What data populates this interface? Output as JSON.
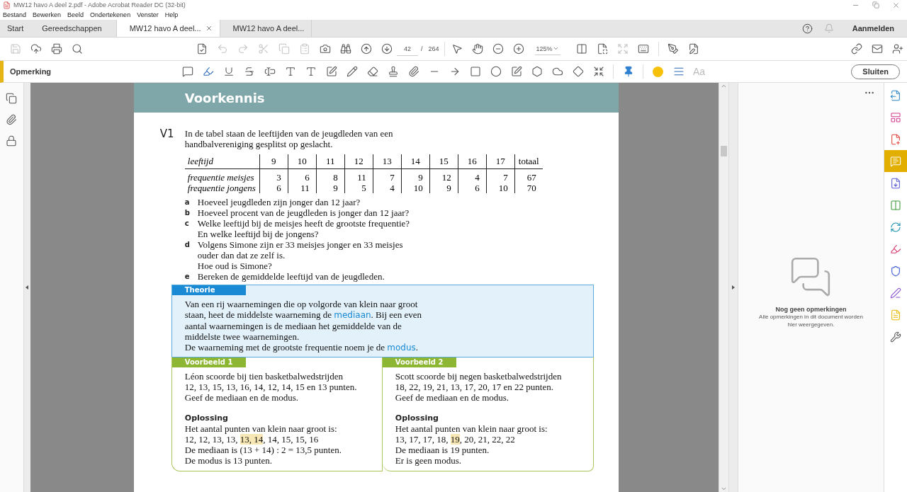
{
  "window": {
    "title": "MW12 havo A deel 2.pdf - Adobe Acrobat Reader DC (32-bit)"
  },
  "menu": [
    "Bestand",
    "Bewerken",
    "Beeld",
    "Ondertekenen",
    "Venster",
    "Help"
  ],
  "tabs": [
    {
      "label": "Start",
      "kind": "nav",
      "selected": false
    },
    {
      "label": "Gereedschappen",
      "kind": "nav",
      "selected": false
    },
    {
      "label": "MW12 havo A deel...",
      "kind": "document",
      "selected": true
    },
    {
      "label": "MW12 havo A deel...",
      "kind": "document",
      "selected": false
    }
  ],
  "account": {
    "sign_in": "Aanmelden"
  },
  "toolbar": {
    "buttons": [
      {
        "disabled": true
      },
      {
        "disabled": false
      },
      {
        "disabled": false
      },
      {
        "disabled": false
      },
      {
        "disabled": false
      },
      {
        "disabled": true
      },
      {
        "disabled": true
      },
      {
        "disabled": true
      },
      {
        "disabled": true
      },
      {
        "disabled": true
      },
      {
        "disabled": false
      },
      {
        "disabled": false
      },
      {
        "disabled": false
      },
      {
        "disabled": false
      },
      {
        "disabled": false
      },
      {
        "disabled": false
      },
      {
        "disabled": false
      },
      {
        "disabled": false
      },
      {
        "disabled": false
      },
      {
        "disabled": false
      },
      {
        "disabled": true
      },
      {
        "disabled": false
      },
      {
        "disabled": false
      },
      {
        "disabled": false
      },
      {
        "disabled": false
      },
      {
        "disabled": false
      },
      {
        "disabled": false
      }
    ],
    "page": {
      "value": "42",
      "separator": "/",
      "total": "264"
    },
    "zoom": {
      "value": "125%"
    }
  },
  "comment_toolbar": {
    "title": "Opmerking",
    "font_sample": "Aa",
    "close": "Sluiten"
  },
  "document": {
    "heading": "Voorkennis",
    "exercise": {
      "number": "V1",
      "intro": [
        "In de tabel staan de leeftijden van de jeugdleden van een",
        "handbalvereniging gesplitst op geslacht."
      ],
      "table": {
        "header": [
          "leeftijd",
          "9",
          "10",
          "11",
          "12",
          "13",
          "14",
          "15",
          "16",
          "17",
          "totaal"
        ],
        "rows": [
          [
            "frequentie meisjes",
            "3",
            "6",
            "8",
            "11",
            "7",
            "9",
            "12",
            "4",
            "7",
            "67"
          ],
          [
            "frequentie jongens",
            "6",
            "11",
            "9",
            "5",
            "4",
            "10",
            "9",
            "6",
            "10",
            "70"
          ]
        ]
      },
      "questions": [
        {
          "label": "a",
          "lines": [
            "Hoeveel jeugdleden zijn jonger dan 12 jaar?"
          ]
        },
        {
          "label": "b",
          "lines": [
            "Hoeveel procent van de jeugdleden is jonger dan 12 jaar?"
          ]
        },
        {
          "label": "c",
          "lines": [
            "Welke leeftijd bij de meisjes heeft de grootste frequentie?",
            "En welke leeftijd bij de jongens?"
          ]
        },
        {
          "label": "d",
          "lines": [
            "Volgens Simone zijn er 33 meisjes jonger en 33 meisjes",
            "ouder dan dat ze zelf is.",
            "Hoe oud is Simone?"
          ]
        },
        {
          "label": "e",
          "lines": [
            "Bereken de gemiddelde leeftijd van de jeugdleden."
          ]
        }
      ]
    },
    "theory": {
      "label": "Theorie",
      "lines": [
        "Van een rij waarnemingen die op volgorde van klein naar groot",
        "staan, heet de middelste waarneming de **mediaan**. Bij een even",
        "aantal waarnemingen is de mediaan het gemiddelde van de",
        "middelste twee waarnemingen.",
        "De waarneming met de grootste frequentie noem je de **modus**."
      ]
    },
    "examples": [
      {
        "label": "Voorbeeld 1",
        "problem": [
          "Léon scoorde bij tien basketbalwedstrijden",
          "12, 13, 15, 13, 16, 14, 12, 14, 15 en 13 punten.",
          "Geef de mediaan en de modus."
        ],
        "solution_title": "Oplossing",
        "solution_intro": "Het aantal punten van klein naar groot is:",
        "sorted": [
          {
            "text": "12, 12, 13, 13, ",
            "highlight": false
          },
          {
            "text": "13, 14",
            "highlight": true
          },
          {
            "text": ", 14, 15, 15, 16",
            "highlight": false
          }
        ],
        "conclusion": [
          "De mediaan is (13 + 14) : 2 = 13,5 punten.",
          "De modus is 13 punten."
        ]
      },
      {
        "label": "Voorbeeld 2",
        "problem": [
          "Scott scoorde bij negen basketbalwedstrijden",
          "18, 22, 19, 21, 13, 17, 20, 17 en 22 punten.",
          "Geef de mediaan en de modus."
        ],
        "solution_title": "Oplossing",
        "solution_intro": "Het aantal punten van klein naar groot is:",
        "sorted": [
          {
            "text": "13, 17, 17, 18, ",
            "highlight": false
          },
          {
            "text": "19",
            "highlight": true
          },
          {
            "text": ", 20, 21, 22, 22",
            "highlight": false
          }
        ],
        "conclusion": [
          "De mediaan is 19 punten.",
          "Er is geen modus."
        ]
      }
    ]
  },
  "comments_panel": {
    "title": "Nog geen opmerkingen",
    "message": [
      "Alle opmerkingen in dit document worden",
      "hier weergegeven."
    ]
  },
  "tool_rail": [
    {
      "selected": false
    },
    {
      "selected": false
    },
    {
      "selected": false
    },
    {
      "selected": true
    },
    {
      "selected": false
    },
    {
      "selected": false
    },
    {
      "selected": false
    },
    {
      "selected": false
    },
    {
      "selected": false
    },
    {
      "selected": false
    },
    {
      "selected": false
    },
    {
      "selected": false
    }
  ]
}
